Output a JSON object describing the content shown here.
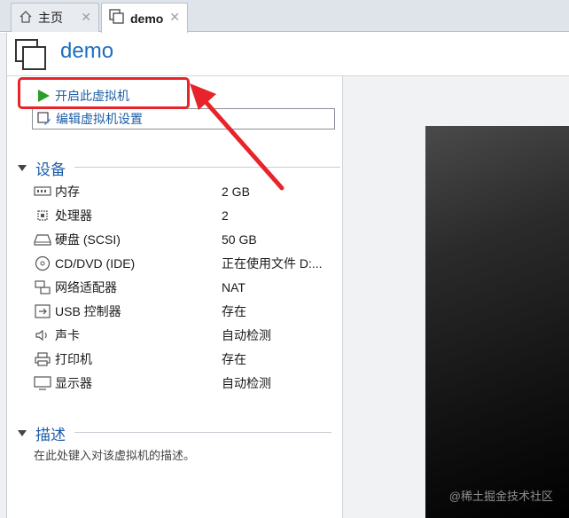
{
  "tabs": [
    {
      "label": "主页",
      "icon": "home-icon"
    },
    {
      "label": "demo",
      "icon": "vm-icon"
    }
  ],
  "vm": {
    "name": "demo"
  },
  "actions": {
    "power_on": "开启此虚拟机",
    "edit_settings": "编辑虚拟机设置"
  },
  "devices": {
    "title": "设备",
    "items": [
      {
        "name": "内存",
        "value": "2 GB",
        "icon": "memory-icon"
      },
      {
        "name": "处理器",
        "value": "2",
        "icon": "cpu-icon"
      },
      {
        "name": "硬盘 (SCSI)",
        "value": "50 GB",
        "icon": "harddisk-icon"
      },
      {
        "name": "CD/DVD (IDE)",
        "value": "正在使用文件 D:...",
        "icon": "cd-icon"
      },
      {
        "name": "网络适配器",
        "value": "NAT",
        "icon": "network-icon"
      },
      {
        "name": "USB 控制器",
        "value": "存在",
        "icon": "usb-icon"
      },
      {
        "name": "声卡",
        "value": "自动检测",
        "icon": "sound-icon"
      },
      {
        "name": "打印机",
        "value": "存在",
        "icon": "printer-icon"
      },
      {
        "name": "显示器",
        "value": "自动检测",
        "icon": "monitor-icon"
      }
    ]
  },
  "description": {
    "title": "描述",
    "placeholder": "在此处键入对该虚拟机的描述。"
  },
  "watermark": "@稀土掘金技术社区",
  "colors": {
    "accent": "#1c5ea8",
    "annotation": "#e8242b",
    "play": "#2a9d2a"
  }
}
